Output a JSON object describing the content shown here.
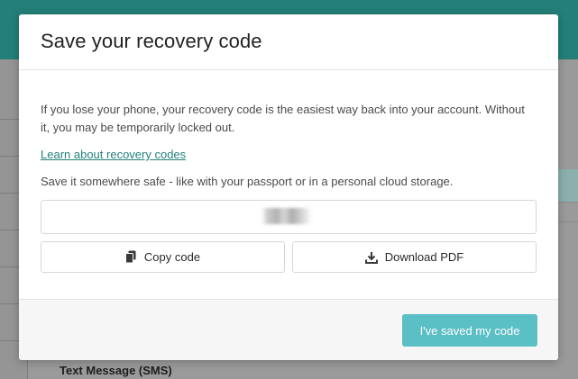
{
  "colors": {
    "top_bar": "#237f78",
    "link": "#23827b",
    "primary_button": "#5bbfc6",
    "overlay": "#8a8a8a"
  },
  "background": {
    "sms_label": "Text Message (SMS)"
  },
  "modal": {
    "title": "Save your recovery code",
    "description": "If you lose your phone, your recovery code is the easiest way back into your account. Without it, you may be temporarily locked out.",
    "learn_link": "Learn about recovery codes",
    "save_note": "Save it somewhere safe - like with your passport or in a personal cloud storage.",
    "code_value_hidden": true,
    "copy_button": {
      "label": "Copy code",
      "icon": "copy-icon"
    },
    "download_button": {
      "label": "Download PDF",
      "icon": "download-icon"
    },
    "confirm_button": "I've saved my code"
  }
}
